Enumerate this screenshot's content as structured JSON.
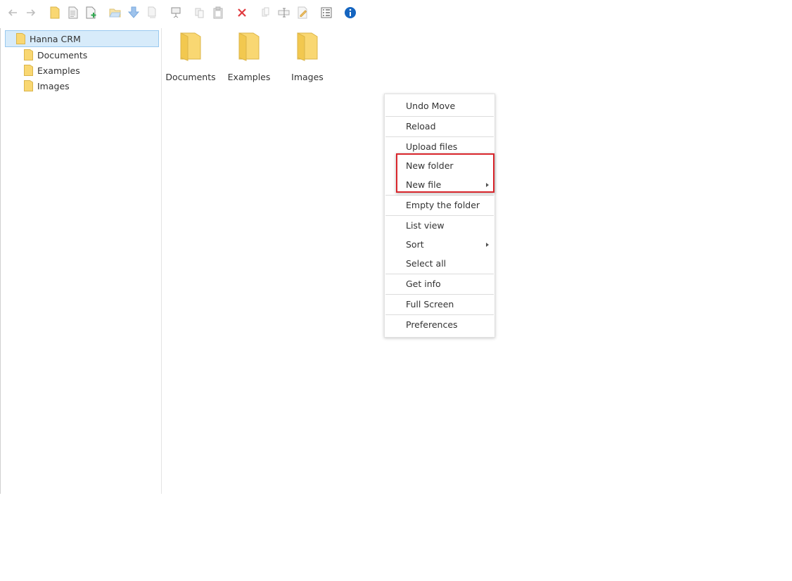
{
  "toolbar": {
    "buttons": [
      {
        "name": "back",
        "icon": "arrow-left-icon"
      },
      {
        "name": "forward",
        "icon": "arrow-right-icon"
      },
      {
        "name": "home",
        "icon": "home-folder-icon"
      },
      {
        "name": "file",
        "icon": "document-icon"
      },
      {
        "name": "new-file",
        "icon": "new-document-icon"
      },
      {
        "name": "open-folder",
        "icon": "open-folder-icon"
      },
      {
        "name": "download",
        "icon": "download-icon"
      },
      {
        "name": "upload",
        "icon": "upload-icon"
      },
      {
        "name": "view",
        "icon": "preview-icon"
      },
      {
        "name": "copy",
        "icon": "copy-icon"
      },
      {
        "name": "paste",
        "icon": "paste-icon"
      },
      {
        "name": "delete",
        "icon": "delete-icon"
      },
      {
        "name": "duplicate",
        "icon": "duplicate-icon"
      },
      {
        "name": "rename",
        "icon": "rename-icon"
      },
      {
        "name": "edit",
        "icon": "edit-icon"
      },
      {
        "name": "list-view",
        "icon": "list-view-icon"
      },
      {
        "name": "info",
        "icon": "info-icon"
      }
    ]
  },
  "tree": {
    "root": "Hanna CRM",
    "children": [
      "Documents",
      "Examples",
      "Images"
    ]
  },
  "folders": [
    "Documents",
    "Examples",
    "Images"
  ],
  "context_menu": {
    "undo": "Undo Move",
    "reload": "Reload",
    "upload": "Upload files",
    "new_folder": "New folder",
    "new_file": "New file",
    "empty": "Empty the folder",
    "list_view": "List view",
    "sort": "Sort",
    "select_all": "Select all",
    "get_info": "Get info",
    "full_screen": "Full Screen",
    "preferences": "Preferences"
  },
  "colors": {
    "folder": "#f9d772",
    "selection": "#d7ebfa",
    "highlight": "#d9262c",
    "info": "#1565c0",
    "delete": "#e0393e"
  }
}
